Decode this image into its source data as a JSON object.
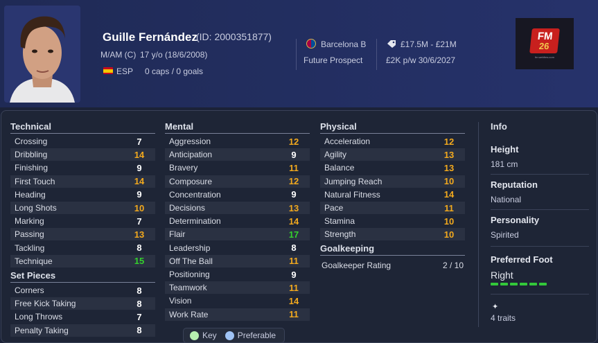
{
  "player": {
    "name": "Guille Fernández",
    "id_text": "(ID: 2000351877)",
    "position": "M/AM (C)",
    "age": "17 y/o (18/6/2008)",
    "nationality": "ESP",
    "caps_goals": "0 caps / 0 goals",
    "club": "Barcelona B",
    "role": "Future Prospect",
    "value_range": "£17.5M - £21M",
    "wage_contract": "£2K p/w  30/6/2027"
  },
  "logo": {
    "line1": "FM",
    "line2": "26",
    "line3": "fm.webfms.com"
  },
  "colors": {
    "white": "#ffffff",
    "yellow": "#f2a91e",
    "green": "#34d02d",
    "panel": "#1e2536",
    "header": "#26326b"
  },
  "sections": {
    "technical": "Technical",
    "set_pieces": "Set Pieces",
    "mental": "Mental",
    "physical": "Physical",
    "goalkeeping": "Goalkeeping",
    "info": "Info"
  },
  "technical": [
    {
      "label": "Crossing",
      "value": "7",
      "tier": "w"
    },
    {
      "label": "Dribbling",
      "value": "14",
      "tier": "y"
    },
    {
      "label": "Finishing",
      "value": "9",
      "tier": "w"
    },
    {
      "label": "First Touch",
      "value": "14",
      "tier": "y"
    },
    {
      "label": "Heading",
      "value": "9",
      "tier": "w"
    },
    {
      "label": "Long Shots",
      "value": "10",
      "tier": "y"
    },
    {
      "label": "Marking",
      "value": "7",
      "tier": "w"
    },
    {
      "label": "Passing",
      "value": "13",
      "tier": "y"
    },
    {
      "label": "Tackling",
      "value": "8",
      "tier": "w"
    },
    {
      "label": "Technique",
      "value": "15",
      "tier": "g"
    }
  ],
  "set_pieces": [
    {
      "label": "Corners",
      "value": "8",
      "tier": "w"
    },
    {
      "label": "Free Kick Taking",
      "value": "8",
      "tier": "w"
    },
    {
      "label": "Long Throws",
      "value": "7",
      "tier": "w"
    },
    {
      "label": "Penalty Taking",
      "value": "8",
      "tier": "w"
    }
  ],
  "mental": [
    {
      "label": "Aggression",
      "value": "12",
      "tier": "y"
    },
    {
      "label": "Anticipation",
      "value": "9",
      "tier": "w"
    },
    {
      "label": "Bravery",
      "value": "11",
      "tier": "y"
    },
    {
      "label": "Composure",
      "value": "12",
      "tier": "y"
    },
    {
      "label": "Concentration",
      "value": "9",
      "tier": "w"
    },
    {
      "label": "Decisions",
      "value": "13",
      "tier": "y"
    },
    {
      "label": "Determination",
      "value": "14",
      "tier": "y"
    },
    {
      "label": "Flair",
      "value": "17",
      "tier": "g"
    },
    {
      "label": "Leadership",
      "value": "8",
      "tier": "w"
    },
    {
      "label": "Off The Ball",
      "value": "11",
      "tier": "y"
    },
    {
      "label": "Positioning",
      "value": "9",
      "tier": "w"
    },
    {
      "label": "Teamwork",
      "value": "11",
      "tier": "y"
    },
    {
      "label": "Vision",
      "value": "14",
      "tier": "y"
    },
    {
      "label": "Work Rate",
      "value": "11",
      "tier": "y"
    }
  ],
  "physical": [
    {
      "label": "Acceleration",
      "value": "12",
      "tier": "y"
    },
    {
      "label": "Agility",
      "value": "13",
      "tier": "y"
    },
    {
      "label": "Balance",
      "value": "13",
      "tier": "y"
    },
    {
      "label": "Jumping Reach",
      "value": "10",
      "tier": "y"
    },
    {
      "label": "Natural Fitness",
      "value": "14",
      "tier": "y"
    },
    {
      "label": "Pace",
      "value": "11",
      "tier": "y"
    },
    {
      "label": "Stamina",
      "value": "10",
      "tier": "y"
    },
    {
      "label": "Strength",
      "value": "10",
      "tier": "y"
    }
  ],
  "goalkeeping": {
    "label": "Goalkeeper Rating",
    "value": "2 / 10"
  },
  "info": {
    "height_label": "Height",
    "height": "181 cm",
    "reputation_label": "Reputation",
    "reputation": "National",
    "personality_label": "Personality",
    "personality": "Spirited",
    "foot_label": "Preferred Foot",
    "foot": "Right",
    "traits": "4 traits"
  },
  "legend": {
    "key": "Key",
    "preferable": "Preferable"
  }
}
